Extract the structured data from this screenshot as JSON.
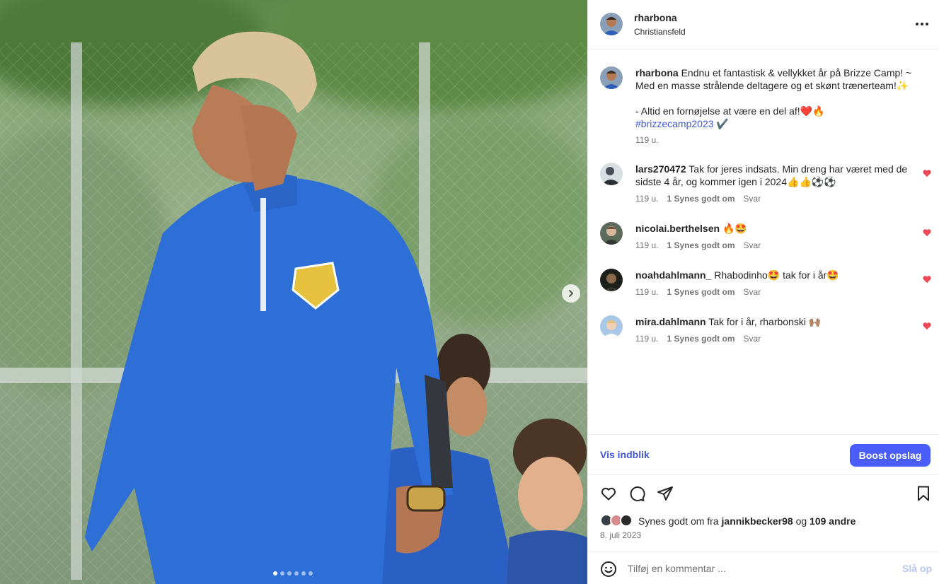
{
  "post": {
    "author": "rharbona",
    "location": "Christiansfeld",
    "carousel": {
      "slides": 6,
      "active_slide": 1
    }
  },
  "caption": {
    "username": "rharbona",
    "text_line1": "Endnu et fantastisk & vellykket år på Brizze Camp! ~ Med en masse strålende deltagere og et skønt trænerteam!✨",
    "text_line2": "- Altid en fornøjelse at være en del af!❤️🔥",
    "hashtag": "#brizzecamp2023",
    "hashtag_suffix": " ✔️",
    "time": "119 u."
  },
  "comments": [
    {
      "username": "lars270472",
      "text": "Tak for jeres indsats. Min dreng har været med de sidste 4 år, og kommer igen i 2024👍👍⚽⚽",
      "time": "119 u.",
      "likes": "1 Synes godt om",
      "reply": "Svar"
    },
    {
      "username": "nicolai.berthelsen",
      "text": "🔥🤩",
      "time": "119 u.",
      "likes": "1 Synes godt om",
      "reply": "Svar"
    },
    {
      "username": "noahdahlmann_",
      "text": "Rhabodinho🤩 tak for i år🤩",
      "time": "119 u.",
      "likes": "1 Synes godt om",
      "reply": "Svar"
    },
    {
      "username": "mira.dahlmann",
      "text": "Tak for i år, rharbonski 🙌🏽",
      "time": "119 u.",
      "likes": "1 Synes godt om",
      "reply": "Svar"
    }
  ],
  "insights": {
    "link": "Vis indblik",
    "boost": "Boost opslag"
  },
  "likes": {
    "prefix": "Synes godt om fra ",
    "user": "jannikbecker98",
    "middle": " og ",
    "others": "109 andre"
  },
  "date": "8. juli 2023",
  "comment_input": {
    "placeholder": "Tilføj en kommentar ...",
    "post_label": "Slå op"
  },
  "icons": [
    "more-icon",
    "chevron-right-icon",
    "heart-icon",
    "comment-icon",
    "share-icon",
    "bookmark-icon",
    "emoji-icon"
  ],
  "colors": {
    "link": "#4056d6",
    "boost": "#4a5df9",
    "heart": "#ed4956",
    "muted": "#737373"
  }
}
